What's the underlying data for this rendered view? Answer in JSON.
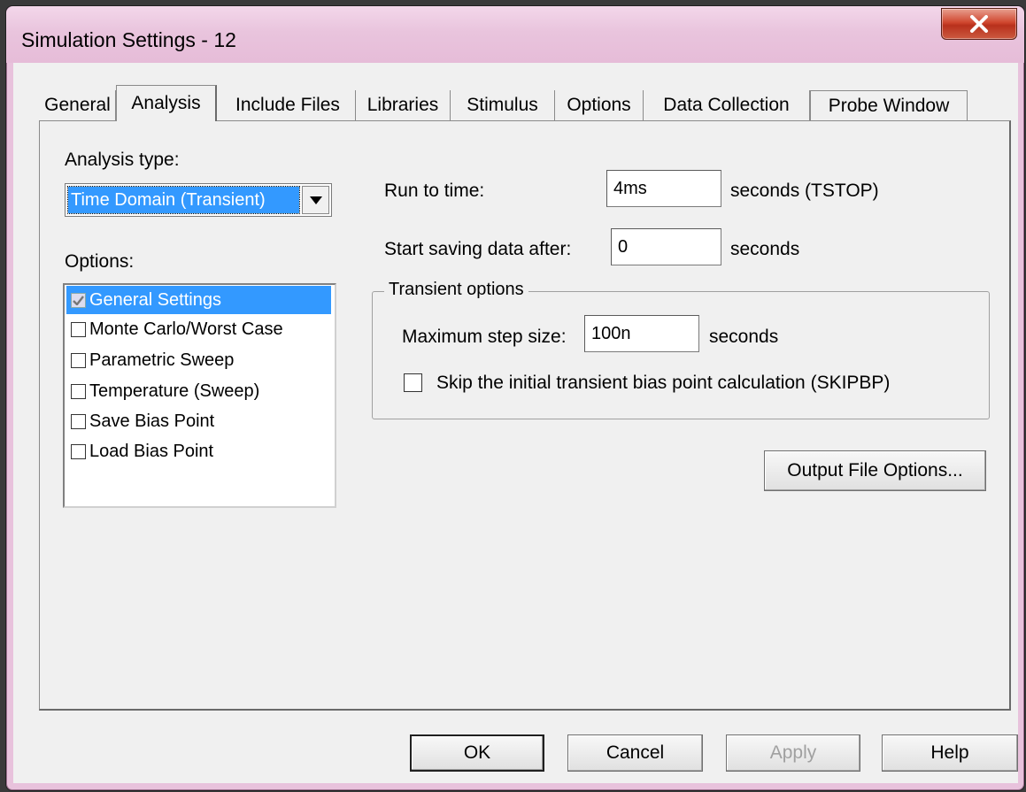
{
  "window": {
    "title": "Simulation Settings - 12"
  },
  "tabs": [
    {
      "label": "General"
    },
    {
      "label": "Analysis"
    },
    {
      "label": "Include Files"
    },
    {
      "label": "Libraries"
    },
    {
      "label": "Stimulus"
    },
    {
      "label": "Options"
    },
    {
      "label": "Data Collection"
    },
    {
      "label": "Probe Window"
    }
  ],
  "active_tab": "Analysis",
  "analysis": {
    "type_label": "Analysis type:",
    "type_value": "Time Domain (Transient)",
    "options_label": "Options:",
    "options": [
      {
        "label": "General Settings",
        "checked": true,
        "selected": true
      },
      {
        "label": "Monte Carlo/Worst Case",
        "checked": false,
        "selected": false
      },
      {
        "label": "Parametric Sweep",
        "checked": false,
        "selected": false
      },
      {
        "label": "Temperature (Sweep)",
        "checked": false,
        "selected": false
      },
      {
        "label": "Save Bias Point",
        "checked": false,
        "selected": false
      },
      {
        "label": "Load Bias Point",
        "checked": false,
        "selected": false
      }
    ]
  },
  "run_to_time": {
    "label": "Run to time:",
    "value": "4ms",
    "unit": "seconds  (TSTOP)"
  },
  "start_saving": {
    "label": "Start saving data after:",
    "value": "0",
    "unit": "seconds"
  },
  "transient": {
    "group_title": "Transient options",
    "max_step_label": "Maximum step size:",
    "max_step_value": "100n",
    "max_step_unit": "seconds",
    "skip_label": "Skip the initial transient bias point calculation  (SKIPBP)",
    "skip_checked": false
  },
  "output_options_button": "Output File Options...",
  "footer": {
    "ok": "OK",
    "cancel": "Cancel",
    "apply": "Apply",
    "help": "Help"
  }
}
